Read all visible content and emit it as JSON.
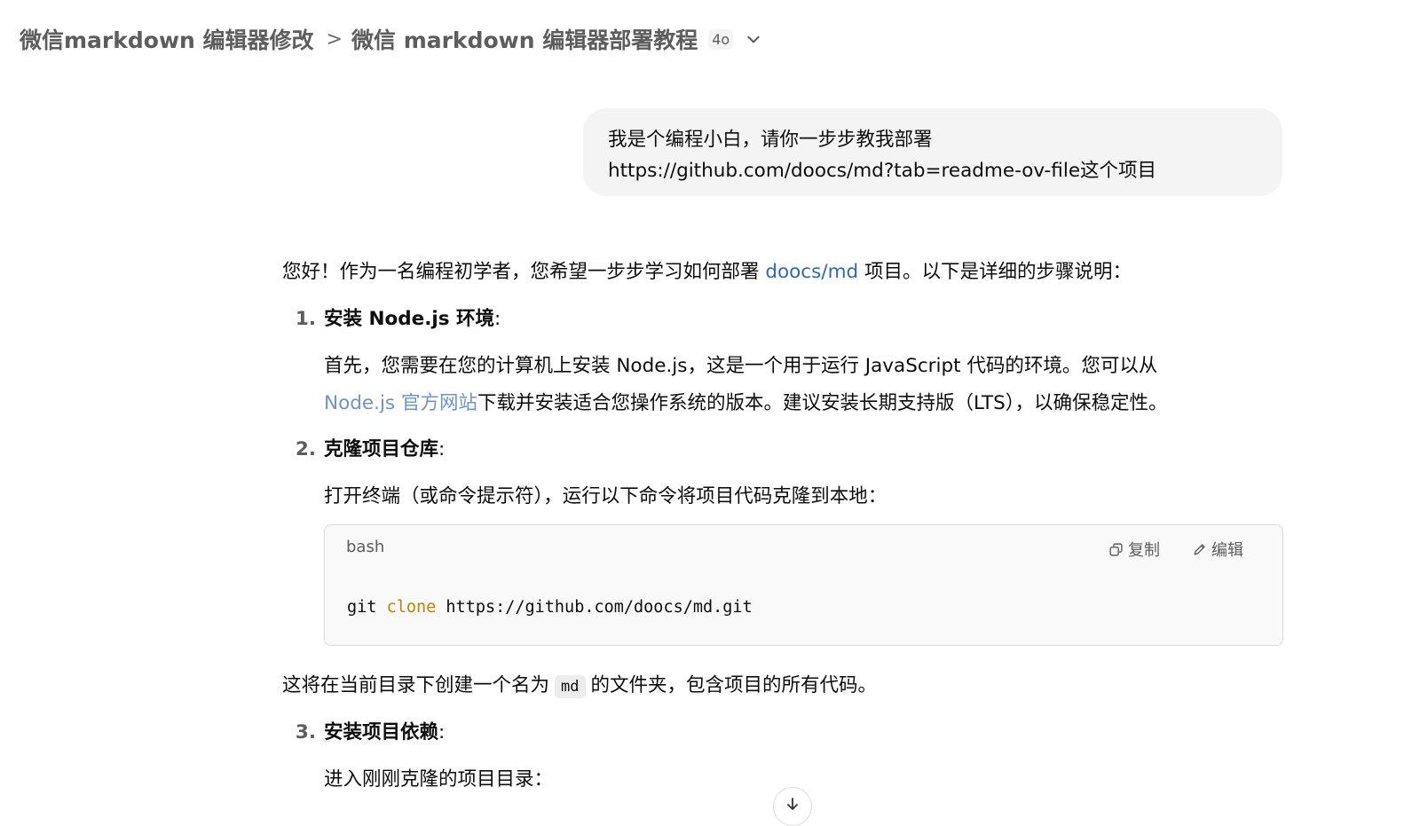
{
  "header": {
    "project": "微信markdown 编辑器修改",
    "separator": ">",
    "conversation": "微信 markdown 编辑器部署教程",
    "model_badge": "4o",
    "dropdown_icon": "chevron-down-icon"
  },
  "user_message": "我是个编程小白，请你一步步教我部署\nhttps://github.com/doocs/md?tab=readme-ov-file这个项目",
  "assistant": {
    "intro_before": "您好！作为一名编程初学者，您希望一步步学习如何部署 ",
    "intro_link": "doocs/md",
    "intro_after": " 项目。以下是详细的步骤说明：",
    "steps": [
      {
        "num": "1.",
        "title": "安装 Node.js 环境",
        "line1": "首先，您需要在您的计算机上安装 Node.js，这是一个用于运行 JavaScript 代码的环境。您可以从",
        "link": "Node.js 官方网站",
        "line2_after": "下载并安装适合您操作系统的版本。建议安装长期支持版（LTS），以确保稳定性。"
      },
      {
        "num": "2.",
        "title": "克隆项目仓库",
        "text": "打开终端（或命令提示符），运行以下命令将项目代码克隆到本地："
      },
      {
        "num": "3.",
        "title": "安装项目依赖",
        "text": "进入刚刚克隆的项目目录："
      }
    ],
    "colon": ":",
    "code": {
      "language": "bash",
      "copy_label": "复制",
      "edit_label": "编辑",
      "cmd": "git",
      "keyword": "clone",
      "arg": "https://github.com/doocs/md.git"
    },
    "after_code_before": "这将在当前目录下创建一个名为",
    "after_code_inline": "md",
    "after_code_after": "的文件夹，包含项目的所有代码。"
  },
  "colors": {
    "link": "#2c6bb5",
    "link_light": "#6d94cf",
    "code_keyword": "#c08200",
    "bubble_bg": "#f4f4f4"
  }
}
